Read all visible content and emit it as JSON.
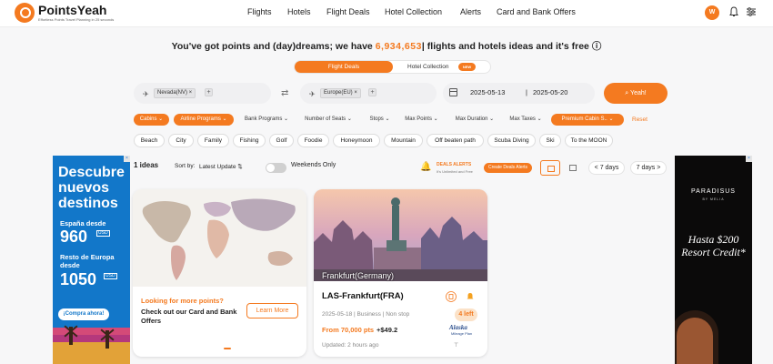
{
  "brand": {
    "name": "PointsYeah",
    "tagline": "Effortless Points Travel Planning in 25 seconds"
  },
  "nav": {
    "links": [
      "Flights",
      "Hotels",
      "Flight Deals",
      "Hotel Collection",
      "Alerts",
      "Card and Bank Offers"
    ],
    "avatar": "W"
  },
  "headline": {
    "before": "You've got points and (day)dreams; we have",
    "count": "6,934,653",
    "after": "flights and hotels ideas and it's free"
  },
  "toggle": {
    "active": "Flight Deals",
    "inactive": "Hotel Collection",
    "badge": "NEW"
  },
  "search": {
    "origin_chip": "Nevada(NV)",
    "destination_chip": "Europe(EU)",
    "start_date": "2025-05-13",
    "end_date": "2025-05-20",
    "button": "Yeah!"
  },
  "filters": [
    {
      "label": "Cabins",
      "active": true
    },
    {
      "label": "Airline Programs",
      "active": true
    },
    {
      "label": "Bank Programs",
      "active": false
    },
    {
      "label": "Number of Seats",
      "active": false
    },
    {
      "label": "Stops",
      "active": false
    },
    {
      "label": "Max Points",
      "active": false
    },
    {
      "label": "Max Duration",
      "active": false
    },
    {
      "label": "Max Taxes",
      "active": false
    },
    {
      "label": "Premium Cabin S..",
      "active": true
    }
  ],
  "reset_label": "Reset",
  "tags": [
    "Beach",
    "City",
    "Family",
    "Fishing",
    "Golf",
    "Foodie",
    "Honeymoon",
    "Mountain",
    "Off beaten path",
    "Scuba Diving",
    "Ski",
    "To the MOON"
  ],
  "results": {
    "count": "1 ideas",
    "sort_label": "Sort by:",
    "sort_value": "Latest Update",
    "weekends": "Weekends Only"
  },
  "alerts": {
    "title": "DEALS ALERTS",
    "subtitle": "It's Unlimited and Free",
    "button": "Create Deals Alerts"
  },
  "day_buttons": [
    "< 7 days",
    "7 days >"
  ],
  "ad_left": {
    "title": "Descubre nuevos destinos",
    "line1": "España desde",
    "price1": "960",
    "line2": "Resto de Europa desde",
    "price2": "1050",
    "currency": "USD",
    "cta": "¡Compra ahora!"
  },
  "ad_right": {
    "brand": "PARADISUS",
    "sub": "BY MELIA",
    "headline": "Hasta $200 Resort Credit*"
  },
  "promo": {
    "question": "Looking for more points?",
    "text": "Check out our Card and Bank Offers",
    "button": "Learn More"
  },
  "deal": {
    "caption": "Frankfurt(Germany)",
    "route": "LAS-Frankfurt(FRA)",
    "meta": "2025-05-18 | Business | Non stop",
    "price": "From 70,000 pts",
    "taxes": "+$49.2",
    "seats": "4 left",
    "airline": "Alaska",
    "program": "Mileage Plan",
    "updated": "Updated: 2 hours ago"
  },
  "colors": {
    "accent": "#f47a20",
    "ad_left_bg": "#1277c9",
    "ad_right_bg": "#0b0a0a"
  }
}
